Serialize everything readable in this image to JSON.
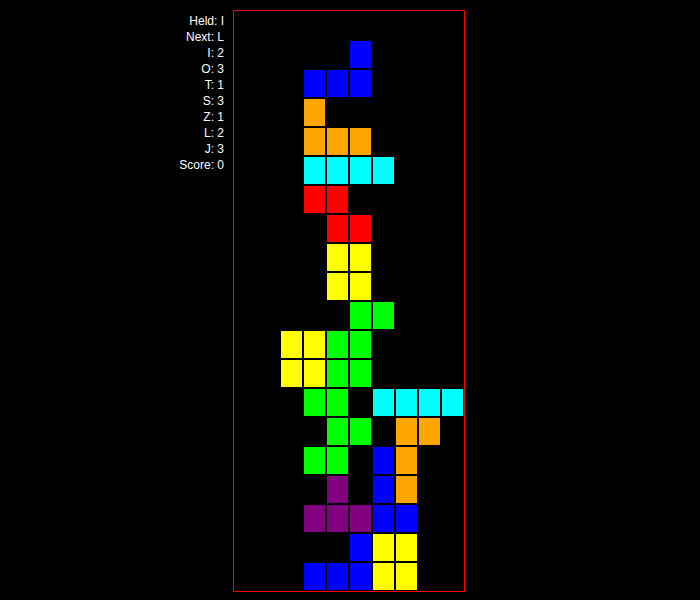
{
  "stats": [
    "Held: I",
    "Next: L",
    "I: 2",
    "O: 3",
    "T: 1",
    "S: 3",
    "Z: 1",
    "L: 2",
    "J: 3",
    "Score: 0"
  ],
  "palette": {
    "B": "#0000ff",
    "O": "#ffa500",
    "C": "#00ffff",
    "R": "#ff0000",
    "Y": "#ffff00",
    "G": "#00ff00",
    "P": "#800080"
  },
  "board": [
    "..........",
    ".....B....",
    "...BBB....",
    "...O......",
    "...OOO....",
    "...CCCC...",
    "...RR.....",
    "....RR....",
    "....YY....",
    "....YY....",
    ".....GG...",
    "..YYGG....",
    "..YYGG....",
    "...GG.CCCC",
    "....GG.OO.",
    "...GG.BO..",
    "....P.BO..",
    "...PPPBB..",
    ".....BYY..",
    "...BBBYY.."
  ]
}
